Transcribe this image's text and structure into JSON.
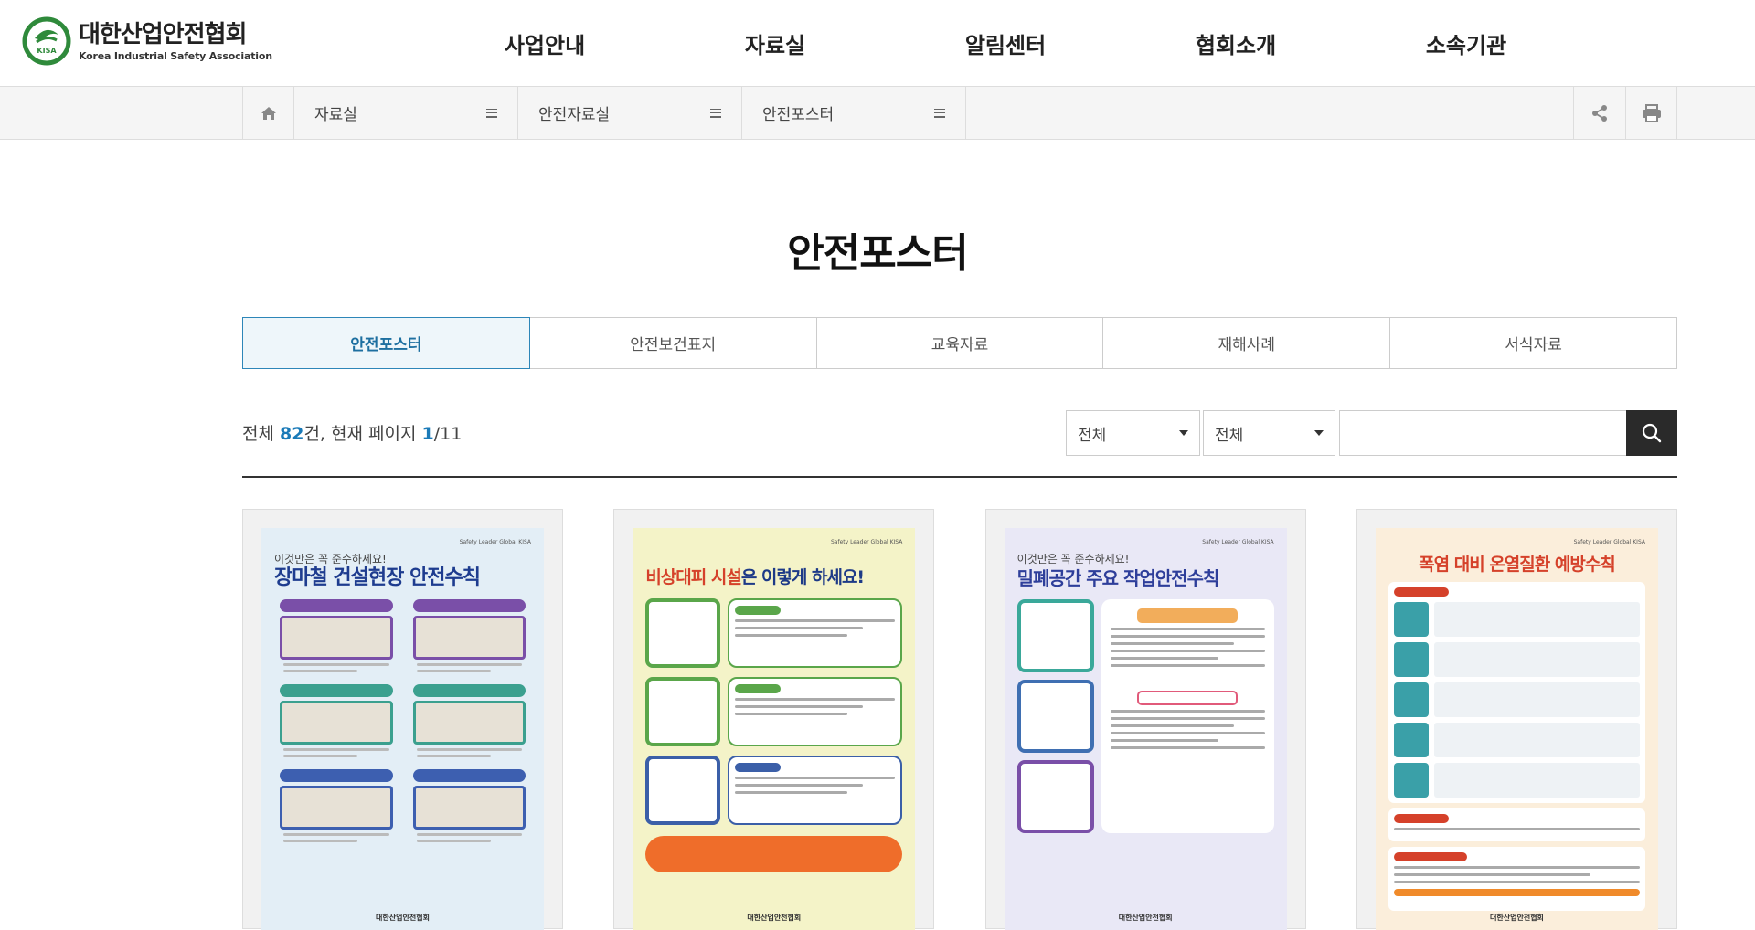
{
  "header": {
    "logo_ko": "대한산업안전협회",
    "logo_en": "Korea Industrial Safety Association",
    "logo_badge": "KISA",
    "nav": [
      "사업안내",
      "자료실",
      "알림센터",
      "협회소개",
      "소속기관"
    ]
  },
  "location": {
    "home_icon": "home-icon",
    "items": [
      "자료실",
      "안전자료실",
      "안전포스터"
    ],
    "tools": [
      "share-icon",
      "print-icon"
    ]
  },
  "page": {
    "title": "안전포스터"
  },
  "tabs": [
    "안전포스터",
    "안전보건표지",
    "교육자료",
    "재해사례",
    "서식자료"
  ],
  "summary": {
    "prefix": "전체 ",
    "total": "82",
    "middle": "건, 현재 페이지 ",
    "page": "1",
    "suffix": "/11"
  },
  "search": {
    "filter1": "전체",
    "filter2": "전체",
    "value": "",
    "button_icon": "search-icon"
  },
  "posters": [
    {
      "header": "Safety Leader Global KISA",
      "subtitle": "이것만은 꼭 준수하세요!",
      "title": "장마철 건설현장 안전수칙",
      "footer": "대한산업안전협회",
      "bg": "#e3eef6",
      "title_color": "#1e3c8f"
    },
    {
      "header": "Safety Leader Global KISA",
      "title_a": "비상대피 시설",
      "title_b": "은 이렇게 하세요!",
      "footer": "대한산업안전협회",
      "bg": "#f4f3c8",
      "title_color": "#d5412a"
    },
    {
      "header": "Safety Leader Global KISA",
      "subtitle": "이것만은 꼭 준수하세요!",
      "title": "밀폐공간 주요 작업안전수칙",
      "footer": "대한산업안전협회",
      "bg": "#e9e8f6",
      "title_color": "#2e3e9a"
    },
    {
      "header": "Safety Leader Global KISA",
      "title": "폭염 대비 온열질환 예방수칙",
      "footer": "대한산업안전협회",
      "bg": "#fbeedb",
      "title_color": "#d5412a"
    }
  ]
}
